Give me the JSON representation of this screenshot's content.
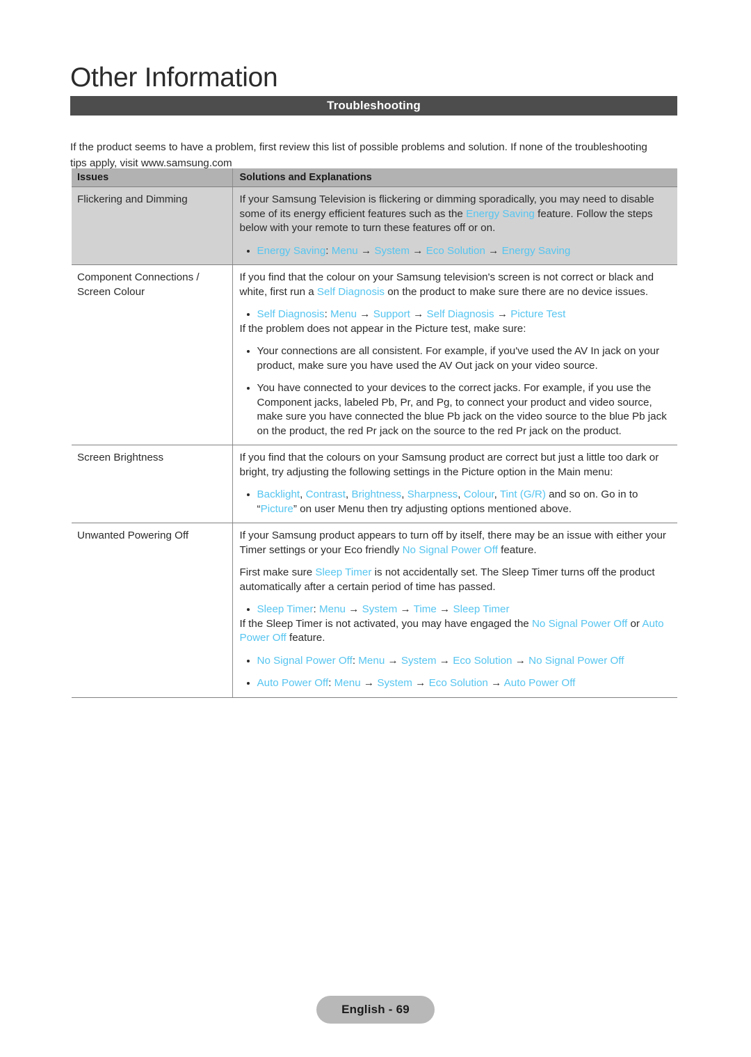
{
  "page": {
    "chapter_title": "Other Information",
    "section_title": "Troubleshooting",
    "intro": "If the product seems to have a problem, first review this list of possible problems and solution. If none of the troubleshooting tips apply, visit www.samsung.com",
    "footer_label": "English - 69"
  },
  "colors": {
    "section_bar_bg": "#4d4d4d",
    "table_header_bg": "#b2b2b2",
    "shaded_row_bg": "#d2d2d2",
    "link": "#56c5f0",
    "text": "#2b2b2b",
    "footer_pill_bg": "#b8b8b8"
  },
  "table": {
    "headers": {
      "issues": "Issues",
      "solutions": "Solutions and Explanations"
    },
    "rows": [
      {
        "issue": "Flickering and Dimming",
        "shaded": true,
        "p1_a": "If your Samsung Television is flickering or dimming sporadically, you may need to disable some of its energy efficient features such as the ",
        "p1_link": "Energy Saving",
        "p1_b": " feature. Follow the steps below with your remote to turn these features off or on.",
        "bullet1_path": "Energy Saving",
        "bullet1_rest_1": "Menu",
        "bullet1_rest_2": "System",
        "bullet1_rest_3": "Eco Solution",
        "bullet1_rest_4": "Energy Saving"
      },
      {
        "issue_line1": "Component Connections /",
        "issue_line2": "Screen Colour",
        "shaded": false,
        "p1_a": "If you find that the colour on your Samsung television's screen is not correct or black and white, first run a ",
        "p1_link": "Self Diagnosis",
        "p1_b": " on the product to make sure there are no device issues.",
        "bullet1_path": "Self Diagnosis",
        "bullet1_rest_1": "Menu",
        "bullet1_rest_2": "Support",
        "bullet1_rest_3": "Self Diagnosis",
        "bullet1_rest_4": "Picture Test",
        "p2": "If the problem does not appear in the Picture test, make sure:",
        "bullet_a": "Your connections are all consistent. For example, if you've used the AV In jack on your product, make sure you have used the AV Out jack on your video source.",
        "bullet_b": "You have connected to your devices to the correct jacks. For example, if you use the Component jacks, labeled Pb, Pr, and Pg, to connect your product and video source, make sure you have connected the blue Pb jack on the video source to the blue Pb jack on the product, the red Pr jack on the source to the red Pr jack on the product."
      },
      {
        "issue": "Screen Brightness",
        "shaded": false,
        "p1": "If you find that the colours on your Samsung product are correct but just a little too dark or bright, try adjusting the following settings in the Picture option in the Main menu:",
        "bullet_links": [
          "Backlight",
          "Contrast",
          "Brightness",
          "Sharpness",
          "Colour",
          "Tint (G/R)"
        ],
        "bullet_tail_a": " and so on. Go in to “",
        "bullet_tail_link": "Picture",
        "bullet_tail_b": "” on user Menu then try adjusting options mentioned above."
      },
      {
        "issue": "Unwanted Powering Off",
        "shaded": false,
        "p1_a": "If your Samsung product appears to turn off by itself, there may be an issue with either your Timer settings or your Eco friendly ",
        "p1_link": "No Signal Power Off",
        "p1_b": " feature.",
        "p2_a": "First make sure ",
        "p2_link": "Sleep Timer",
        "p2_b": " is not accidentally set. The Sleep Timer turns off the product automatically after a certain period of time has passed.",
        "bullet1_path": "Sleep Timer",
        "bullet1_rest_1": "Menu",
        "bullet1_rest_2": "System",
        "bullet1_rest_3": "Time",
        "bullet1_rest_4": "Sleep Timer",
        "p3_a": "If the Sleep Timer is not activated, you may have engaged the ",
        "p3_link1": "No Signal Power Off",
        "p3_mid": " or ",
        "p3_link2": "Auto Power Off",
        "p3_b": " feature.",
        "bullet2_path": "No Signal Power Off",
        "bullet2_rest_1": "Menu",
        "bullet2_rest_2": "System",
        "bullet2_rest_3": "Eco Solution",
        "bullet2_rest_4": "No Signal Power Off",
        "bullet3_path": "Auto Power Off",
        "bullet3_rest_1": "Menu",
        "bullet3_rest_2": "System",
        "bullet3_rest_3": "Eco Solution",
        "bullet3_rest_4": "Auto Power Off"
      }
    ]
  }
}
